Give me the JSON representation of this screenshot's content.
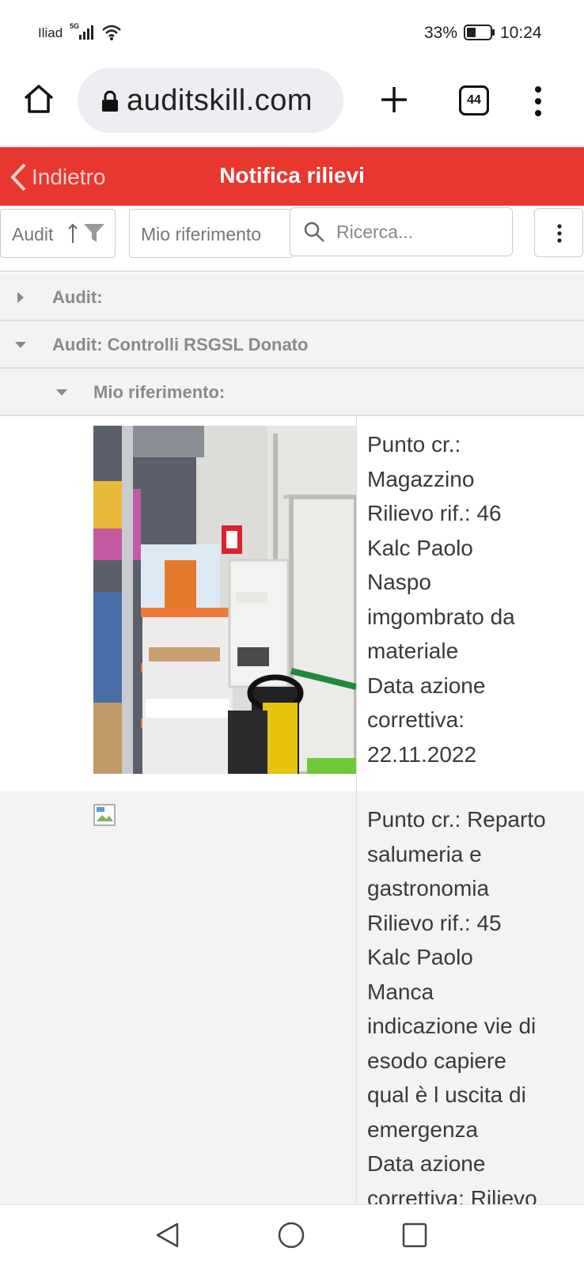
{
  "status_bar": {
    "carrier": "Iliad",
    "network": "5G",
    "battery_pct": "33%",
    "time": "10:24"
  },
  "browser": {
    "url": "auditskill.com",
    "tab_count": "44"
  },
  "header": {
    "back_label": "Indietro",
    "title": "Notifica rilievi"
  },
  "toolbar": {
    "audit_label": "Audit",
    "ref_label": "Mio riferimento",
    "search_placeholder": "Ricerca..."
  },
  "groups": [
    {
      "label": "Audit:",
      "expanded": false
    },
    {
      "label": "Audit: Controlli RSGSL Donato",
      "expanded": true
    },
    {
      "label": "Mio riferimento:",
      "expanded": true
    }
  ],
  "rows": [
    {
      "lines": [
        "Punto cr.:",
        "Magazzino",
        "Rilievo rif.: 46",
        "Kalc Paolo",
        "Naspo",
        "imgombrato da",
        "materiale",
        "Data azione",
        "correttiva:",
        "22.11.2022"
      ]
    },
    {
      "lines": [
        "Punto cr.: Reparto",
        "salumeria e",
        "gastronomia",
        "Rilievo rif.: 45",
        "Kalc Paolo",
        "Manca",
        "indicazione vie di",
        "esodo capiere",
        "qual è l uscita di",
        "emergenza",
        "Data azione",
        "correttiva: Rilievo"
      ]
    }
  ],
  "colors": {
    "header_red": "#e8372f",
    "group_bg": "#f3f3f3",
    "row_alt_bg": "#f3f3f4"
  }
}
